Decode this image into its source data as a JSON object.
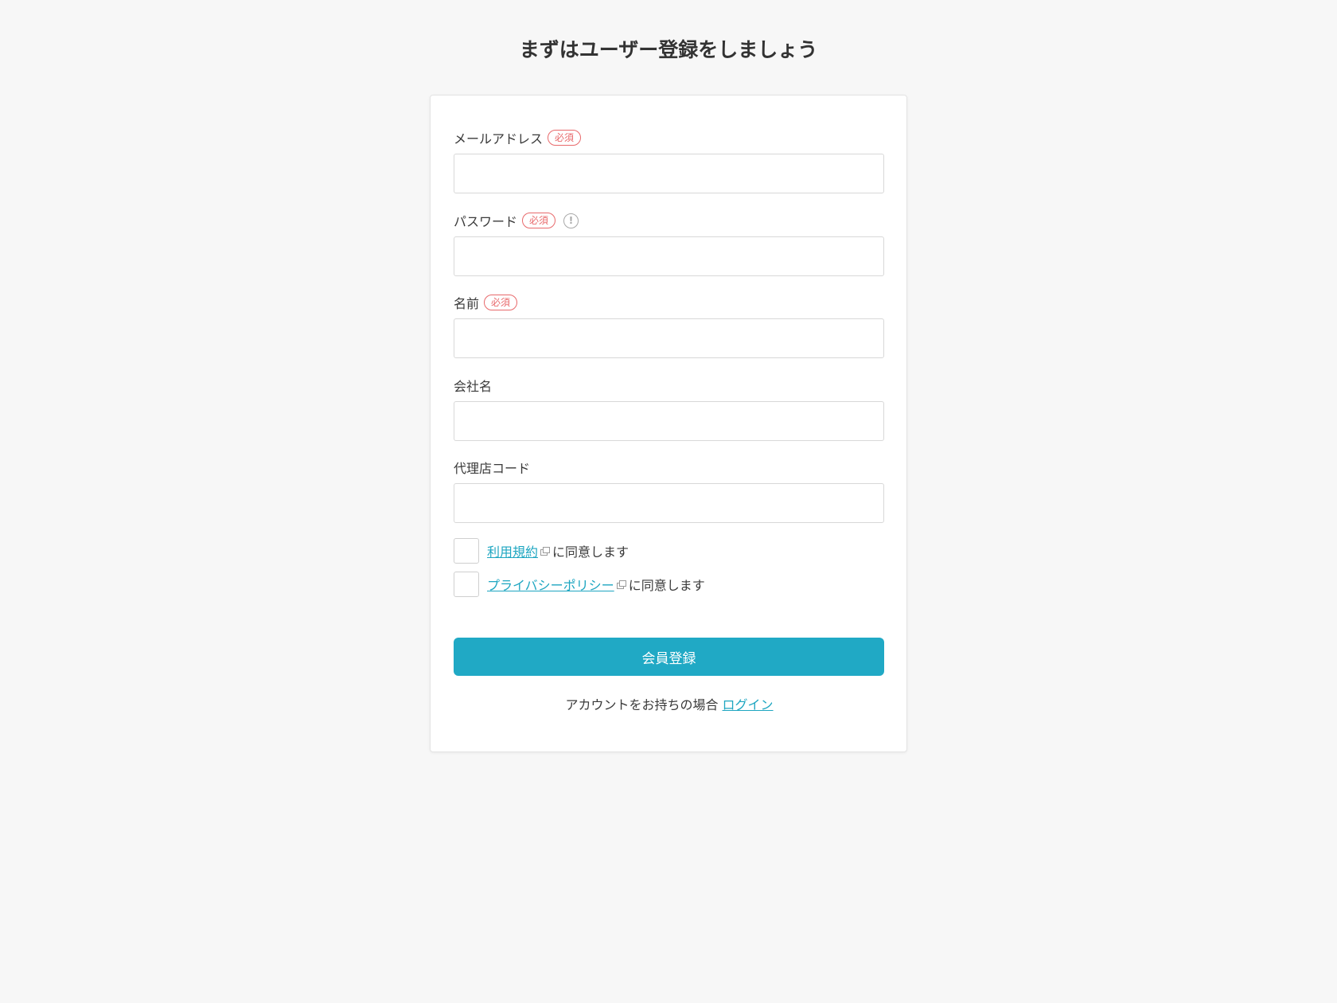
{
  "page": {
    "title": "まずはユーザー登録をしましょう"
  },
  "form": {
    "email": {
      "label": "メールアドレス",
      "required_badge": "必須",
      "value": ""
    },
    "password": {
      "label": "パスワード",
      "required_badge": "必須",
      "info_icon": "!",
      "value": ""
    },
    "name": {
      "label": "名前",
      "required_badge": "必須",
      "value": ""
    },
    "company": {
      "label": "会社名",
      "value": ""
    },
    "agency_code": {
      "label": "代理店コード",
      "value": ""
    },
    "terms": {
      "link_text": "利用規約",
      "suffix": "に同意します",
      "checked": false
    },
    "privacy": {
      "link_text": "プライバシーポリシー",
      "suffix": "に同意します",
      "checked": false
    },
    "submit_label": "会員登録"
  },
  "footer": {
    "prompt": "アカウントをお持ちの場合",
    "login_link": "ログイン"
  },
  "colors": {
    "accent": "#20a9c5",
    "link": "#1ea6c1",
    "required": "#e8696b",
    "background": "#f7f7f7"
  },
  "icons": {
    "info": "info-icon",
    "external_link": "external-link-icon"
  }
}
